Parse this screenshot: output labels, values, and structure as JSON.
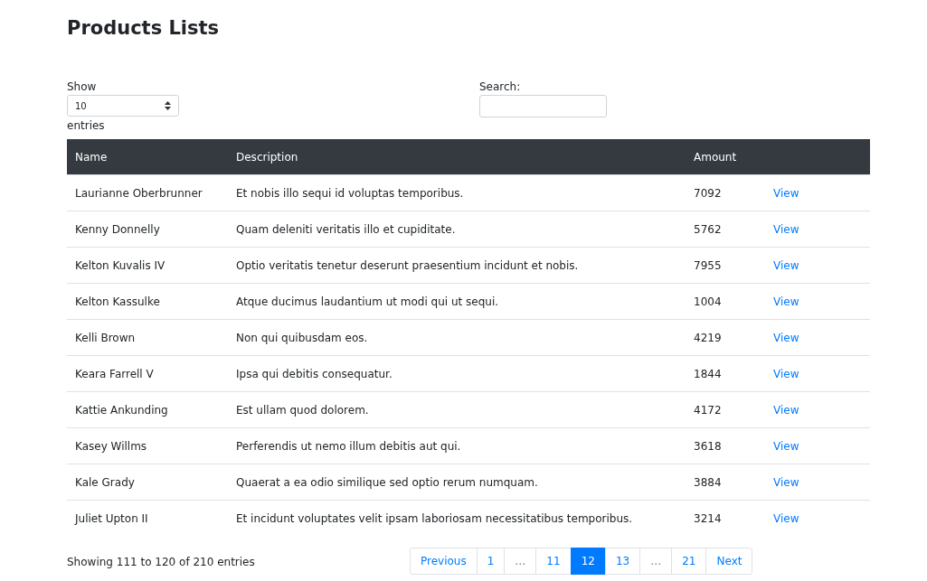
{
  "title": "Products Lists",
  "length_control": {
    "label_before": "Show",
    "value": "10",
    "label_after": "entries"
  },
  "search": {
    "label": "Search:"
  },
  "table": {
    "columns": [
      "Name",
      "Description",
      "Amount",
      ""
    ],
    "rows": [
      {
        "name": "Laurianne Oberbrunner",
        "description": "Et nobis illo sequi id voluptas temporibus.",
        "amount": "7092",
        "action": "View"
      },
      {
        "name": "Kenny Donnelly",
        "description": "Quam deleniti veritatis illo et cupiditate.",
        "amount": "5762",
        "action": "View"
      },
      {
        "name": "Kelton Kuvalis IV",
        "description": "Optio veritatis tenetur deserunt praesentium incidunt et nobis.",
        "amount": "7955",
        "action": "View"
      },
      {
        "name": "Kelton Kassulke",
        "description": "Atque ducimus laudantium ut modi qui ut sequi.",
        "amount": "1004",
        "action": "View"
      },
      {
        "name": "Kelli Brown",
        "description": "Non qui quibusdam eos.",
        "amount": "4219",
        "action": "View"
      },
      {
        "name": "Keara Farrell V",
        "description": "Ipsa qui debitis consequatur.",
        "amount": "1844",
        "action": "View"
      },
      {
        "name": "Kattie Ankunding",
        "description": "Est ullam quod dolorem.",
        "amount": "4172",
        "action": "View"
      },
      {
        "name": "Kasey Willms",
        "description": "Perferendis ut nemo illum debitis aut qui.",
        "amount": "3618",
        "action": "View"
      },
      {
        "name": "Kale Grady",
        "description": "Quaerat a ea odio similique sed optio rerum numquam.",
        "amount": "3884",
        "action": "View"
      },
      {
        "name": "Juliet Upton II",
        "description": "Et incidunt voluptates velit ipsam laboriosam necessitatibus temporibus.",
        "amount": "3214",
        "action": "View"
      }
    ]
  },
  "info": "Showing 111 to 120 of 210 entries",
  "pagination": [
    {
      "label": "Previous",
      "kind": "link",
      "selected": false
    },
    {
      "label": "1",
      "kind": "link",
      "selected": false
    },
    {
      "label": "…",
      "kind": "ellipsis",
      "selected": false
    },
    {
      "label": "11",
      "kind": "link",
      "selected": false
    },
    {
      "label": "12",
      "kind": "link",
      "selected": true
    },
    {
      "label": "13",
      "kind": "link",
      "selected": false
    },
    {
      "label": "…",
      "kind": "ellipsis",
      "selected": false
    },
    {
      "label": "21",
      "kind": "link",
      "selected": false
    },
    {
      "label": "Next",
      "kind": "link",
      "selected": false
    }
  ]
}
